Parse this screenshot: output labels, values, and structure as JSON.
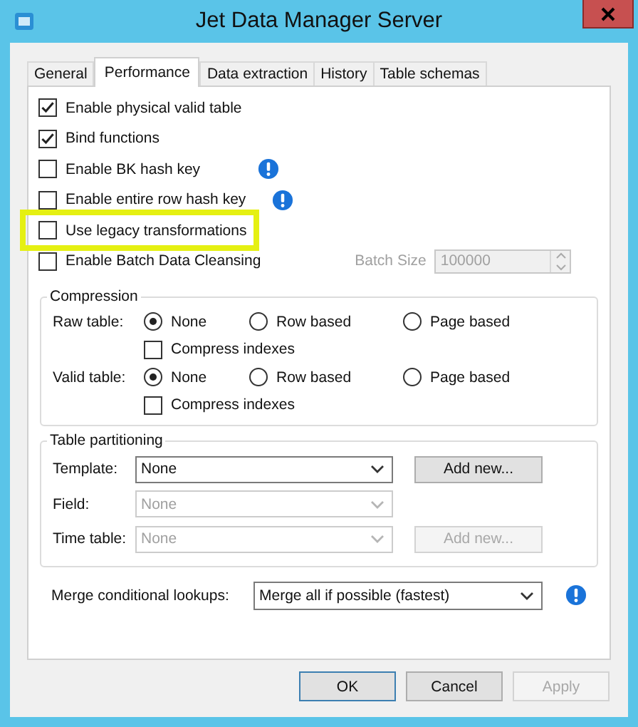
{
  "window": {
    "title": "Jet Data Manager Server"
  },
  "tabs": [
    {
      "label": "General",
      "selected": false
    },
    {
      "label": "Performance",
      "selected": true
    },
    {
      "label": "Data extraction",
      "selected": false
    },
    {
      "label": "History",
      "selected": false
    },
    {
      "label": "Table schemas",
      "selected": false
    }
  ],
  "options": [
    {
      "label": "Enable physical valid table",
      "checked": true,
      "info": false,
      "highlighted": false
    },
    {
      "label": "Bind functions",
      "checked": true,
      "info": false,
      "highlighted": false
    },
    {
      "label": "Enable BK hash key",
      "checked": false,
      "info": true,
      "highlighted": false
    },
    {
      "label": "Enable entire row hash key",
      "checked": false,
      "info": true,
      "highlighted": false
    },
    {
      "label": "Use legacy transformations",
      "checked": false,
      "info": false,
      "highlighted": true
    },
    {
      "label": "Enable Batch Data Cleansing",
      "checked": false,
      "info": false,
      "highlighted": false,
      "batch_size": {
        "label": "Batch Size",
        "value": "100000",
        "disabled": true
      }
    }
  ],
  "compression": {
    "title": "Compression",
    "rows": [
      {
        "label": "Raw table:",
        "choices": [
          {
            "label": "None",
            "selected": true
          },
          {
            "label": "Row based",
            "selected": false
          },
          {
            "label": "Page based",
            "selected": false
          }
        ],
        "compress_indexes": {
          "label": "Compress indexes",
          "checked": false
        }
      },
      {
        "label": "Valid table:",
        "choices": [
          {
            "label": "None",
            "selected": true
          },
          {
            "label": "Row based",
            "selected": false
          },
          {
            "label": "Page based",
            "selected": false
          }
        ],
        "compress_indexes": {
          "label": "Compress indexes",
          "checked": false
        }
      }
    ]
  },
  "partitioning": {
    "title": "Table partitioning",
    "rows": [
      {
        "label": "Template:",
        "value": "None",
        "disabled": false,
        "button": {
          "label": "Add new...",
          "disabled": false
        }
      },
      {
        "label": "Field:",
        "value": "None",
        "disabled": true
      },
      {
        "label": "Time table:",
        "value": "None",
        "disabled": true,
        "button": {
          "label": "Add new...",
          "disabled": true
        }
      }
    ]
  },
  "merge": {
    "label": "Merge conditional lookups:",
    "value": "Merge all if possible (fastest)",
    "info": true
  },
  "buttons": [
    {
      "label": "OK",
      "disabled": false,
      "default": true
    },
    {
      "label": "Cancel",
      "disabled": false,
      "default": false
    },
    {
      "label": "Apply",
      "disabled": true,
      "default": false
    }
  ]
}
